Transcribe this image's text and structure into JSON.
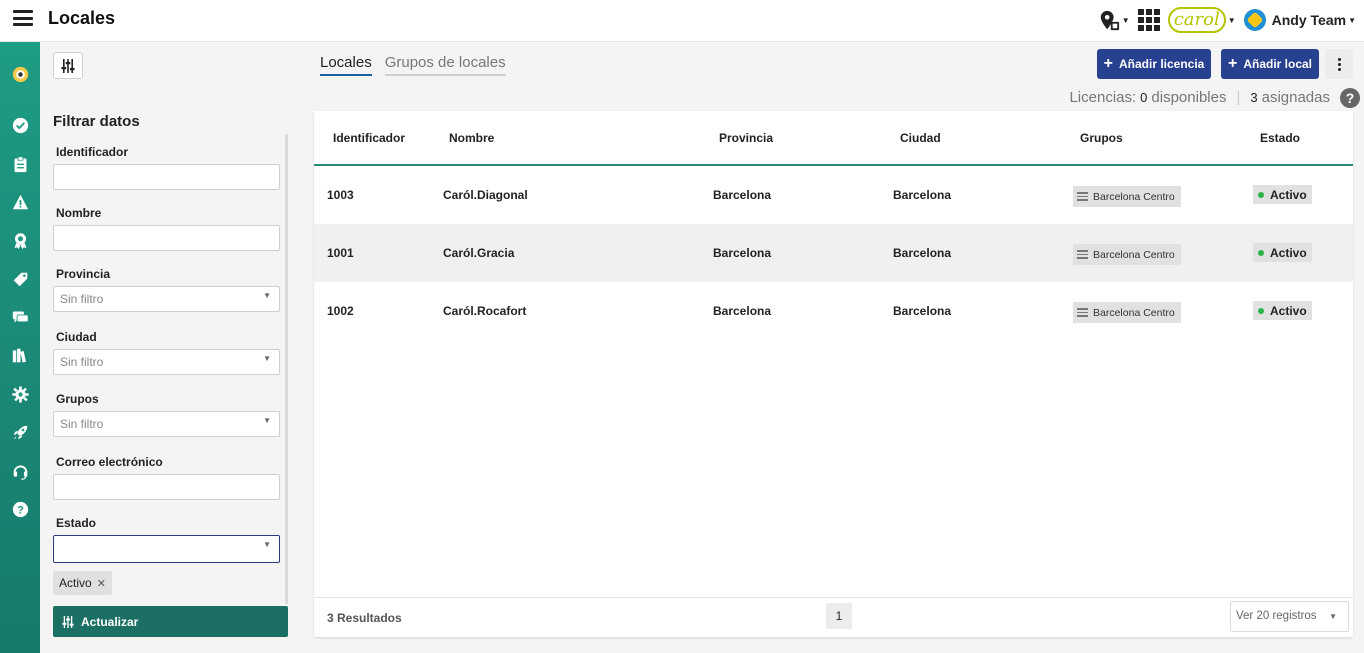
{
  "app": {
    "title": "Locales"
  },
  "user": {
    "team": "Andy Team"
  },
  "brand": {
    "logo_text": "carol"
  },
  "colors": {
    "sidebar": "#1e9c84",
    "primary_button": "#27408f",
    "update_button": "#1b6f63",
    "header_rule": "#2a8a78",
    "status_active": "#2ab44a"
  },
  "nav_icons": [
    "eye-icon",
    "check-circle-icon",
    "clipboard-icon",
    "warning-icon",
    "badge-icon",
    "tag-icon",
    "chat-icon",
    "library-icon",
    "gear-icon",
    "rocket-icon",
    "headset-icon",
    "help-icon"
  ],
  "filters": {
    "title": "Filtrar datos",
    "identificador": {
      "label": "Identificador",
      "value": ""
    },
    "nombre": {
      "label": "Nombre",
      "value": ""
    },
    "provincia": {
      "label": "Provincia",
      "value": "Sin filtro"
    },
    "ciudad": {
      "label": "Ciudad",
      "value": "Sin filtro"
    },
    "grupos": {
      "label": "Grupos",
      "value": "Sin filtro"
    },
    "correo": {
      "label": "Correo electrónico",
      "value": ""
    },
    "estado": {
      "label": "Estado",
      "value": "",
      "chip": "Activo"
    },
    "update_label": "Actualizar"
  },
  "tabs": [
    {
      "label": "Locales",
      "active": true
    },
    {
      "label": "Grupos de locales",
      "active": false
    }
  ],
  "actions": {
    "add_license": "Añadir licencia",
    "add_local": "Añadir local"
  },
  "licenses": {
    "label": "Licencias:",
    "available_count": "0",
    "available_text": "disponibles",
    "assigned_count": "3",
    "assigned_text": "asignadas"
  },
  "table": {
    "columns": [
      "Identificador",
      "Nombre",
      "Provincia",
      "Ciudad",
      "Grupos",
      "Estado"
    ],
    "rows": [
      {
        "id": "1003",
        "nombre": "Caról.Diagonal",
        "provincia": "Barcelona",
        "ciudad": "Barcelona",
        "grupo": "Barcelona Centro",
        "estado": "Activo"
      },
      {
        "id": "1001",
        "nombre": "Caról.Gracia",
        "provincia": "Barcelona",
        "ciudad": "Barcelona",
        "grupo": "Barcelona Centro",
        "estado": "Activo"
      },
      {
        "id": "1002",
        "nombre": "Caról.Rocafort",
        "provincia": "Barcelona",
        "ciudad": "Barcelona",
        "grupo": "Barcelona Centro",
        "estado": "Activo"
      }
    ],
    "results": "3 Resultados",
    "page": "1",
    "per_page": "Ver 20 registros"
  }
}
